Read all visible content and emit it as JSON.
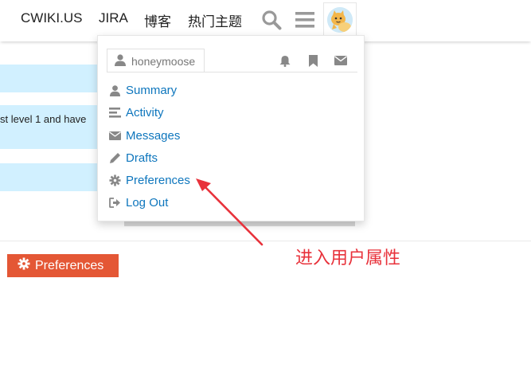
{
  "header": {
    "nav": [
      "CWIKI.US",
      "JIRA",
      "博客",
      "热门主题"
    ]
  },
  "page": {
    "truncated_text": "st level 1 and have",
    "preferences_button": "Preferences"
  },
  "user_menu": {
    "username": "honeymoose",
    "items": [
      {
        "label": "Summary",
        "icon": "user-icon"
      },
      {
        "label": "Activity",
        "icon": "list-icon"
      },
      {
        "label": "Messages",
        "icon": "envelope-icon"
      },
      {
        "label": "Drafts",
        "icon": "pencil-icon"
      },
      {
        "label": "Preferences",
        "icon": "gear-icon"
      },
      {
        "label": "Log Out",
        "icon": "sign-out-icon"
      }
    ]
  },
  "annotation": {
    "text": "进入用户属性",
    "color": "#e8323b"
  },
  "colors": {
    "accent": "#e45735",
    "link": "#0e76bd",
    "highlight": "#d1f0ff"
  }
}
